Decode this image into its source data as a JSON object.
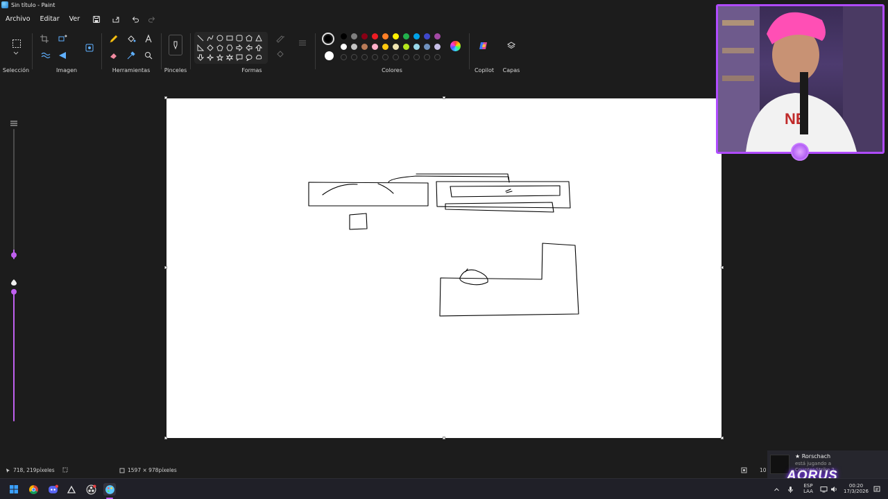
{
  "window": {
    "title": "Sin título - Paint"
  },
  "menu": {
    "items": [
      "Archivo",
      "Editar",
      "Ver"
    ]
  },
  "ribbon": {
    "groups": {
      "selection": "Selección",
      "image": "Imagen",
      "tools": "Herramientas",
      "brushes": "Pinceles",
      "shapes": "Formas",
      "colors": "Colores",
      "copilot": "Copilot",
      "layers": "Capas"
    },
    "palette_row1": [
      "#000000",
      "#7f7f7f",
      "#880015",
      "#ed1c24",
      "#ff7f27",
      "#fff200",
      "#22b14c",
      "#00a2e8",
      "#3f48cc",
      "#a349a4"
    ],
    "palette_row2": [
      "#ffffff",
      "#c3c3c3",
      "#b97a57",
      "#ffaec9",
      "#ffc90e",
      "#efe4b0",
      "#b5e61d",
      "#99d9ea",
      "#7092be",
      "#c8bfe7"
    ],
    "primary_color": "#000000",
    "secondary_color": "#ffffff"
  },
  "status": {
    "cursor_position": "718, 219píxeles",
    "canvas_size": "1597 × 978píxeles",
    "zoom": "10"
  },
  "notification": {
    "name": "★ Rorschach",
    "line1": "está jugando a",
    "line2": "Counter-Strike 2"
  },
  "overlay": {
    "brand": "AORUS"
  },
  "tray": {
    "lang1": "ESP",
    "lang2": "LAA",
    "time": "00:20",
    "date": "17/3/2026"
  },
  "colors": {
    "accent": "#b04bff",
    "slider": "#c060f0"
  }
}
